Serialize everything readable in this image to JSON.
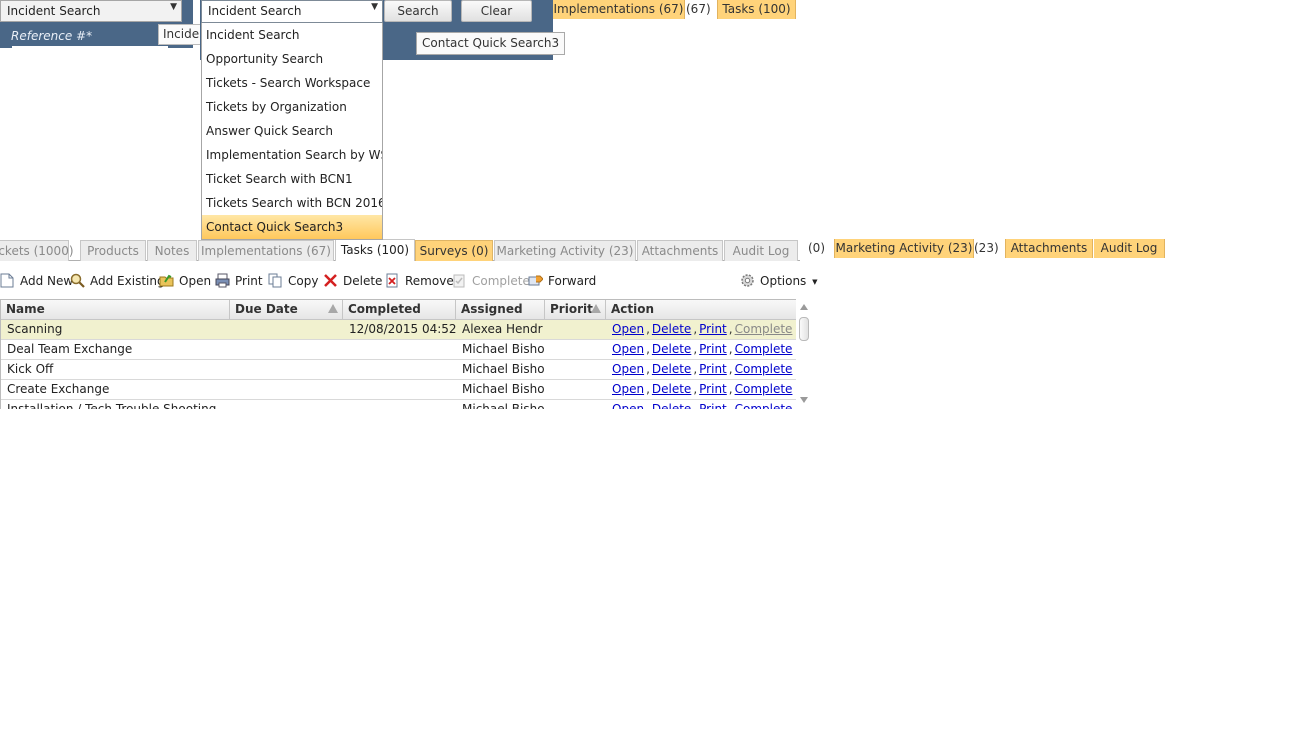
{
  "search_left": {
    "selector_value": "Incident Search",
    "reference_label": "Reference #*",
    "tooltip_text": "Inciden"
  },
  "search_right": {
    "selector_value": "Incident Search",
    "search_label": "Search",
    "clear_label": "Clear",
    "saved_search_chip": "Contact Quick Search3"
  },
  "dropdown": {
    "items": [
      "Incident Search",
      "Opportunity Search",
      "Tickets - Search Workspace",
      "Tickets by Organization",
      "Answer Quick Search",
      "Implementation Search by WS ID",
      "Ticket Search with BCN1",
      "Tickets Search with BCN 2016",
      "Contact Quick Search3"
    ],
    "selected_index": 8
  },
  "floating_tabs_top": {
    "implementations": "Implementations (67)",
    "implementations_count": "(67)",
    "tasks": "Tasks (100)"
  },
  "tabs": [
    {
      "label": "ickets (1000)",
      "state": "inactive"
    },
    {
      "label": "Products",
      "state": "inactive"
    },
    {
      "label": "Notes",
      "state": "inactive"
    },
    {
      "label": "Implementations (67)",
      "state": "inactive"
    },
    {
      "label": "Tasks (100)",
      "state": "active"
    },
    {
      "label": "Surveys (0)",
      "state": "highlight"
    },
    {
      "label": "Marketing Activity (23)",
      "state": "inactive"
    },
    {
      "label": "Attachments",
      "state": "inactive"
    },
    {
      "label": "Audit Log",
      "state": "inactive"
    }
  ],
  "floating_tabs_right": {
    "surveys_count": "(0)",
    "marketing": "Marketing Activity (23)",
    "marketing_count": "(23)",
    "attachments": "Attachments",
    "audit_log": "Audit Log"
  },
  "toolbar": {
    "add_new": "Add New",
    "add_existing": "Add Existing",
    "open": "Open",
    "print": "Print",
    "copy": "Copy",
    "delete": "Delete",
    "remove": "Remove",
    "complete": "Complete",
    "forward": "Forward",
    "options": "Options"
  },
  "grid": {
    "columns": [
      "Name",
      "Due Date",
      "Completed",
      "Assigned",
      "Priorit",
      "Action"
    ],
    "rows": [
      {
        "name": "Scanning",
        "due": "",
        "completed": "12/08/2015 04:52",
        "assigned": "Alexea Hendr",
        "priority": "",
        "complete_enabled": false
      },
      {
        "name": "Deal Team Exchange",
        "due": "",
        "completed": "",
        "assigned": "Michael Bisho",
        "priority": "",
        "complete_enabled": true
      },
      {
        "name": "Kick Off",
        "due": "",
        "completed": "",
        "assigned": "Michael Bisho",
        "priority": "",
        "complete_enabled": true
      },
      {
        "name": "Create Exchange",
        "due": "",
        "completed": "",
        "assigned": "Michael Bisho",
        "priority": "",
        "complete_enabled": true
      },
      {
        "name": "Installation / Tech Trouble Shooting",
        "due": "",
        "completed": "",
        "assigned": "Michael Bisho",
        "priority": "",
        "complete_enabled": true
      }
    ],
    "action_labels": {
      "open": "Open",
      "delete": "Delete",
      "print": "Print",
      "complete": "Complete",
      "separator": ","
    }
  },
  "colors": {
    "panel_bg": "#4a6787",
    "highlight_tab": "#ffd37a",
    "selected_row": "#f1f1cf",
    "link": "#0000cc"
  }
}
